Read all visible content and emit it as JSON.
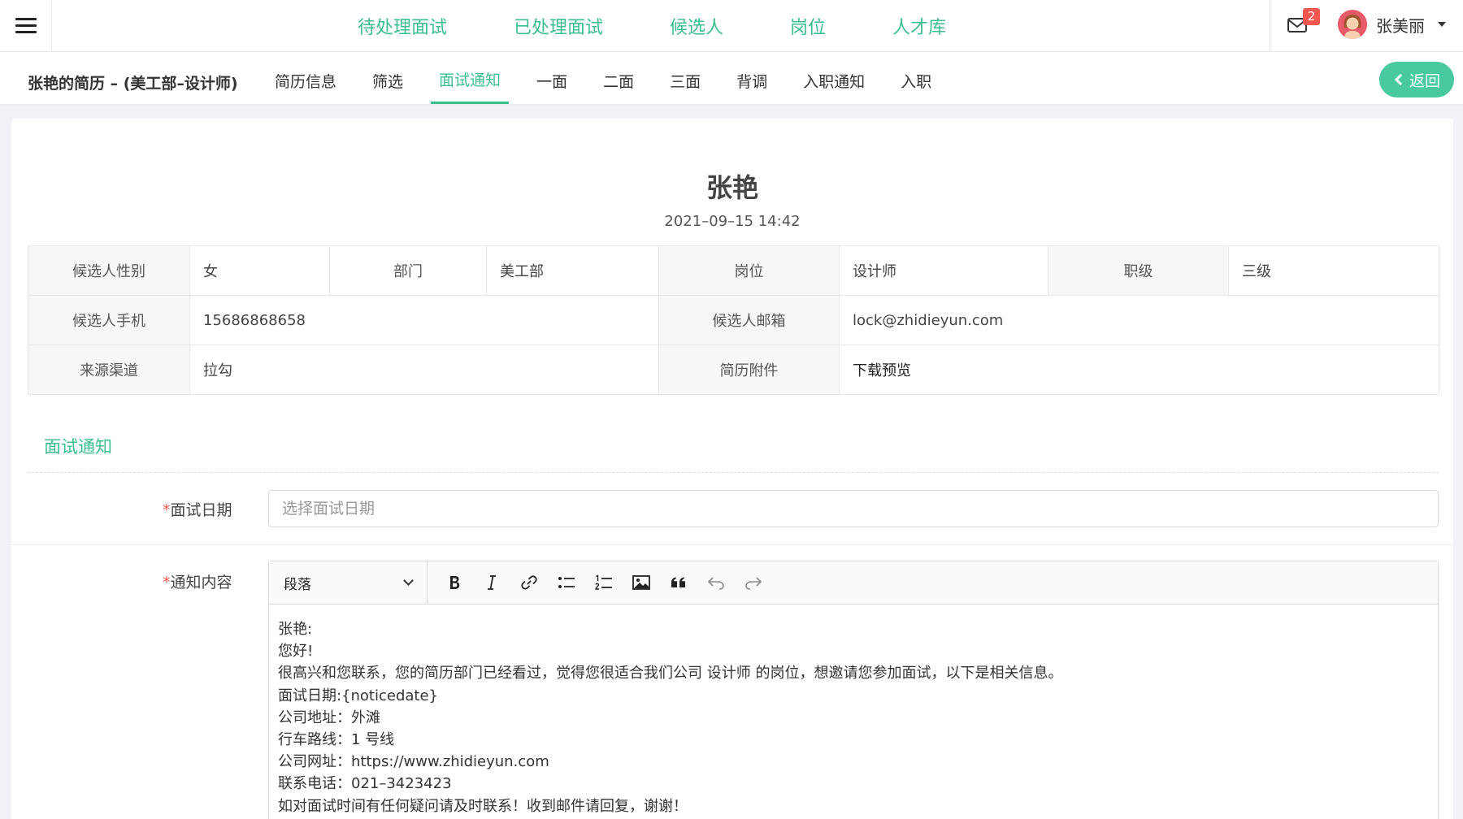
{
  "topnav": {
    "links": [
      "待处理面试",
      "已处理面试",
      "候选人",
      "岗位",
      "人才库"
    ],
    "mail_badge": "2",
    "username": "张美丽"
  },
  "subnav": {
    "resume_title": "张艳的简历 – (美工部–设计师)",
    "tabs": [
      "简历信息",
      "筛选",
      "面试通知",
      "一面",
      "二面",
      "三面",
      "背调",
      "入职通知",
      "入职"
    ],
    "active_tab": "面试通知",
    "back_label": "返回"
  },
  "candidate": {
    "name": "张艳",
    "datetime": "2021–09–15 14:42",
    "info": {
      "gender_label": "候选人性别",
      "gender": "女",
      "dept_label": "部门",
      "dept": "美工部",
      "post_label": "岗位",
      "post": "设计师",
      "level_label": "职级",
      "level": "三级",
      "phone_label": "候选人手机",
      "phone": "15686868658",
      "email_label": "候选人邮箱",
      "email": "lock@zhidieyun.com",
      "source_label": "来源渠道",
      "source": "拉勾",
      "attach_label": "简历附件",
      "attach": "下载预览"
    }
  },
  "notice": {
    "section_title": "面试通知",
    "date_label": "面试日期",
    "date_placeholder": "选择面试日期",
    "content_label": "通知内容",
    "editor": {
      "block_format": "段落",
      "lines": [
        "张艳:",
        "您好!",
        "很高兴和您联系，您的简历部门已经看过，觉得您很适合我们公司 设计师 的岗位，想邀请您参加面试，以下是相关信息。",
        "面试日期:{noticedate}",
        "公司地址：外滩",
        "行车路线：1 号线",
        "公司网址：https://www.zhidieyun.com",
        "联系电话：021–3423423",
        "如对面试时间有任何疑问请及时联系！收到邮件请回复，谢谢！"
      ]
    }
  },
  "colors": {
    "accent": "#3cbf8e",
    "badge": "#f5564f",
    "back_button": "#48c9a0"
  }
}
